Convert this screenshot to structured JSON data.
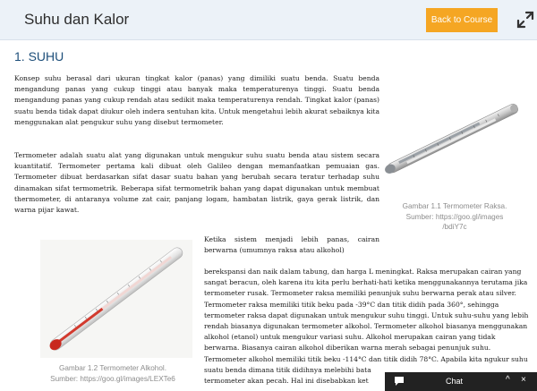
{
  "header": {
    "title": "Suhu dan Kalor",
    "back_label": "Back to Course",
    "expand_icon": "expand-icon"
  },
  "section": {
    "title": "1. SUHU"
  },
  "paragraphs": {
    "p1": "Konsep suhu berasal dari ukuran tingkat kalor (panas) yang dimiliki suatu benda. Suatu benda mengandung panas yang cukup tinggi atau banyak maka temperaturenya tinggi. Suatu benda mengandung panas yang cukup rendah atau sedikit maka temperaturenya rendah. Tingkat kalor (panas) suatu benda tidak dapat diukur oleh indera sentuhan kita. Untuk mengetahui lebih akurat sebaiknya kita menggunakan alat pengukur suhu yang disebut termometer.",
    "p2": "Termometer adalah suatu alat yang digunakan untuk mengukur suhu suatu benda atau sistem secara kuantitatif. Termometer pertama kali dibuat oleh Galileo dengan memanfaatkan pemuaian gas. Termometer dibuat berdasarkan sifat dasar suatu bahan yang berubah secara teratur terhadap suhu dinamakan sifat termometrik. Beberapa sifat termometrik bahan yang dapat digunakan untuk membuat thermometer, di antaranya volume zat cair, panjang logam, hambatan listrik, gaya gerak listrik, dan warna pijar kawat.",
    "p3a": "Ketika sistem menjadi lebih panas, cairan berwarna (umumnya raksa atau alkohol)",
    "p3_lines": [
      "berekspansi dan naik dalam tabung, dan harga L meningkat. Raksa merupakan cairan yang",
      "sangat beracun, oleh karena itu kita perlu berhati-hati ketika menggunakannya terutama jika",
      "termometer rusak. Termometer raksa memiliki penunjuk suhu berwarna perak atau silver.",
      "Termometer raksa memiliki titik beku pada -39°C dan titik didih pada 360°, sehingga",
      "termometer raksa dapat digunakan untuk mengukur suhu tinggi. Untuk suhu-suhu yang lebih",
      "rendah biasanya digunakan termometer alkohol. Termometer alkohol biasanya menggunakan",
      "alkohol (etanol) untuk mengukur variasi suhu. Alkohol merupakan cairan yang tidak",
      "berwarna. Biasanya cairan alkohol diberikan warna merah sebagai penunjuk suhu.",
      "Termometer alkohol memiliki titik beku -114°C dan titik didih 78°C. Apabila kita ngukur suhu",
      "suatu benda dimana titik didihnya melebihi bata",
      "termometer akan pecah. Hal ini disebabkan ket"
    ]
  },
  "figures": {
    "fig1_caption": [
      "Gambar 1.1 Termometer Raksa.",
      "Sumber: https://goo.gl/images",
      "/bdiY7c"
    ],
    "fig2_caption": [
      "Gambar 1.2 Termometer Alkohol.",
      "Sumber: https://goo.gl/images/LEXTe6"
    ]
  },
  "chat": {
    "label": "Chat",
    "min": "^",
    "close": "×",
    "icon": "chat-bubble-icon"
  },
  "colors": {
    "accent": "#f5a623",
    "header_bg": "#ecf2f8",
    "title": "#1e4f7a"
  }
}
